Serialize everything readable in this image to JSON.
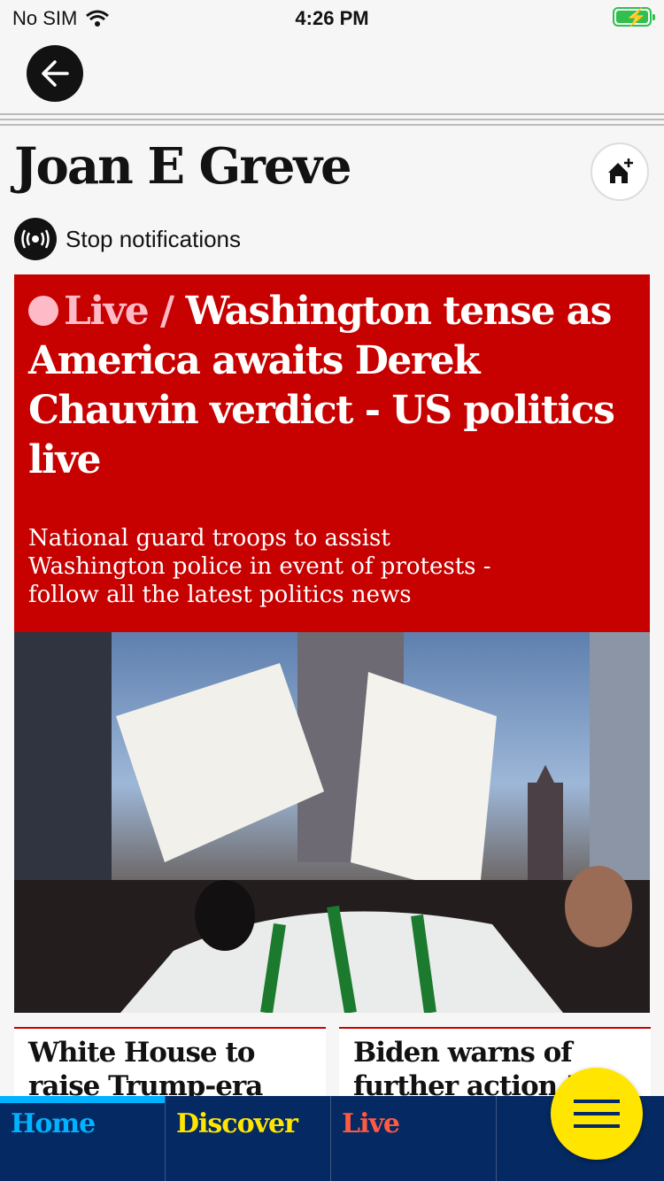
{
  "status_bar": {
    "carrier": "No SIM",
    "time": "4:26 PM"
  },
  "header": {
    "title": "Joan E Greve",
    "notification_label": "Stop notifications"
  },
  "lead": {
    "kicker": "Live /",
    "headline": "Washington tense as America awaits Derek Chauvin verdict - US politics live",
    "standfirst": "National guard troops to assist Washington police in event of protests - follow all the latest politics news"
  },
  "cards": [
    {
      "title": "White House to raise Trump-era refugee"
    },
    {
      "title": "Biden warns of further action 'if"
    }
  ],
  "nav": {
    "tabs": [
      {
        "label": "Home",
        "color": "#00b2ff"
      },
      {
        "label": "Discover",
        "color": "#ffe500"
      },
      {
        "label": "Live",
        "color": "#ff5943"
      }
    ]
  },
  "colors": {
    "live_red": "#c70000",
    "nav_blue": "#052962",
    "fab_yellow": "#ffe500"
  }
}
